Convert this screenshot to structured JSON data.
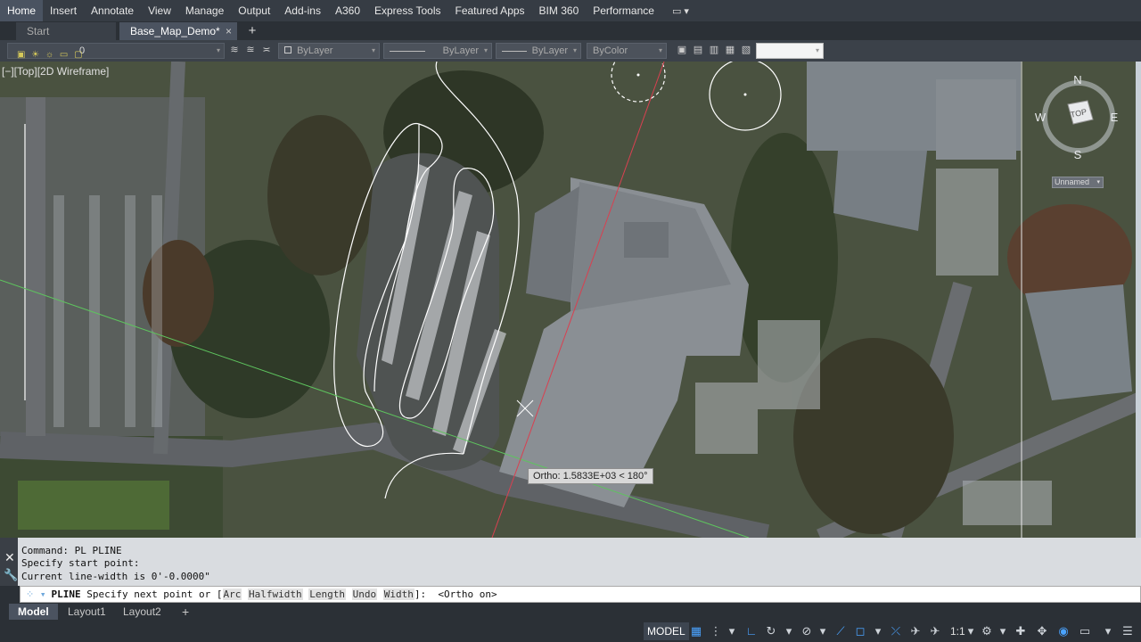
{
  "ribbon": {
    "tabs": [
      "Home",
      "Insert",
      "Annotate",
      "View",
      "Manage",
      "Output",
      "Add-ins",
      "A360",
      "Express Tools",
      "Featured Apps",
      "BIM 360",
      "Performance"
    ],
    "active_tab": "Home",
    "extra": "▭ ▾"
  },
  "file_tabs": {
    "start": "Start",
    "active": "Base_Map_Demo*",
    "close": "×",
    "add": "+"
  },
  "properties": {
    "layer_value": "0",
    "color": "ByLayer",
    "linetype": "ByLayer",
    "lineweight": "ByLayer",
    "plotstyle": "ByColor",
    "blank": ""
  },
  "viewport": {
    "label": "[−][Top][2D Wireframe]",
    "viewcube": {
      "n": "N",
      "s": "S",
      "e": "E",
      "w": "W",
      "face": "TOP"
    },
    "ucs": "Unnamed",
    "tooltip": "Ortho: 1.5833E+03 < 180°"
  },
  "command": {
    "history": [
      "Command: PL PLINE",
      "Specify start point:",
      "Current line-width is 0'-0.0000\""
    ],
    "prompt_name": "PLINE",
    "prompt_text": "Specify next point or [",
    "options": [
      "Arc",
      "Halfwidth",
      "Length",
      "Undo",
      "Width"
    ],
    "prompt_end": "]:  <Ortho on>"
  },
  "layout_tabs": {
    "model": "Model",
    "layout1": "Layout1",
    "layout2": "Layout2",
    "add": "+"
  },
  "status": {
    "model": "MODEL",
    "scale": "1:1"
  },
  "colors": {
    "accent": "#4aa3ff",
    "ortho_line": "#d94050",
    "track_line": "#5ec45e",
    "polyline": "#ffffff"
  }
}
